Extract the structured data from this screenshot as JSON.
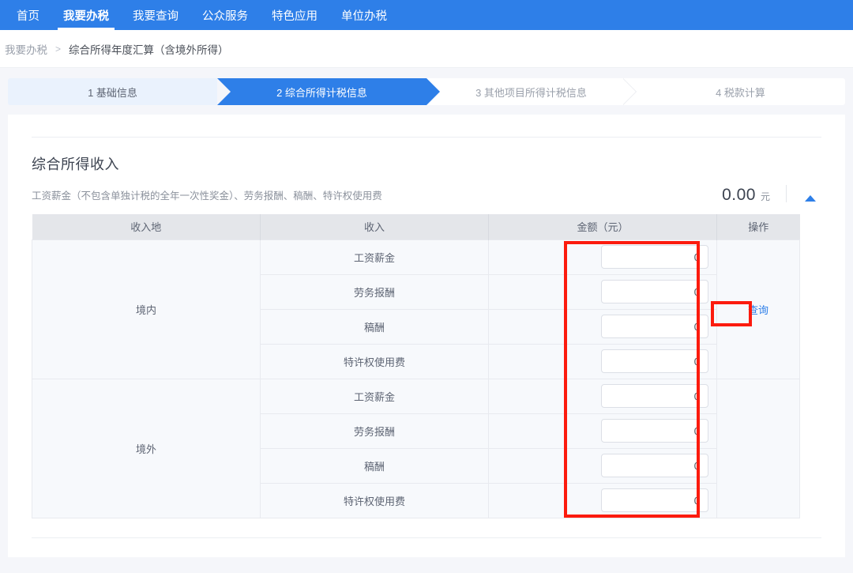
{
  "topnav": {
    "items": [
      {
        "label": "首页",
        "active": false
      },
      {
        "label": "我要办税",
        "active": true
      },
      {
        "label": "我要查询",
        "active": false
      },
      {
        "label": "公众服务",
        "active": false
      },
      {
        "label": "特色应用",
        "active": false
      },
      {
        "label": "单位办税",
        "active": false
      }
    ]
  },
  "breadcrumb": {
    "root": "我要办税",
    "separator": "＞",
    "current": "综合所得年度汇算（含境外所得）"
  },
  "stepper": {
    "steps": [
      {
        "label": "1 基础信息",
        "state": "done"
      },
      {
        "label": "2 综合所得计税信息",
        "state": "active"
      },
      {
        "label": "3 其他项目所得计税信息",
        "state": "todo"
      },
      {
        "label": "4 税款计算",
        "state": "todo"
      }
    ]
  },
  "section": {
    "title": "综合所得收入",
    "description": "工资薪金（不包含单独计税的全年一次性奖金）、劳务报酬、稿酬、特许权使用费",
    "total_amount": "0.00",
    "total_unit": "元",
    "collapse_icon": "caret-up-icon"
  },
  "table": {
    "headers": [
      "收入地",
      "收入",
      "金额（元）",
      "操作"
    ],
    "groups": [
      {
        "region": "境内",
        "action_label": "查询",
        "rows": [
          {
            "income_type": "工资薪金",
            "amount": "0"
          },
          {
            "income_type": "劳务报酬",
            "amount": "0"
          },
          {
            "income_type": "稿酬",
            "amount": "0"
          },
          {
            "income_type": "特许权使用费",
            "amount": "0"
          }
        ]
      },
      {
        "region": "境外",
        "action_label": "",
        "rows": [
          {
            "income_type": "工资薪金",
            "amount": "0"
          },
          {
            "income_type": "劳务报酬",
            "amount": "0"
          },
          {
            "income_type": "稿酬",
            "amount": "0"
          },
          {
            "income_type": "特许权使用费",
            "amount": "0"
          }
        ]
      }
    ]
  },
  "annotations": [
    {
      "name": "amount-column-highlight",
      "color": "#fc1b0e"
    },
    {
      "name": "query-link-highlight",
      "color": "#fc1b0e"
    }
  ]
}
